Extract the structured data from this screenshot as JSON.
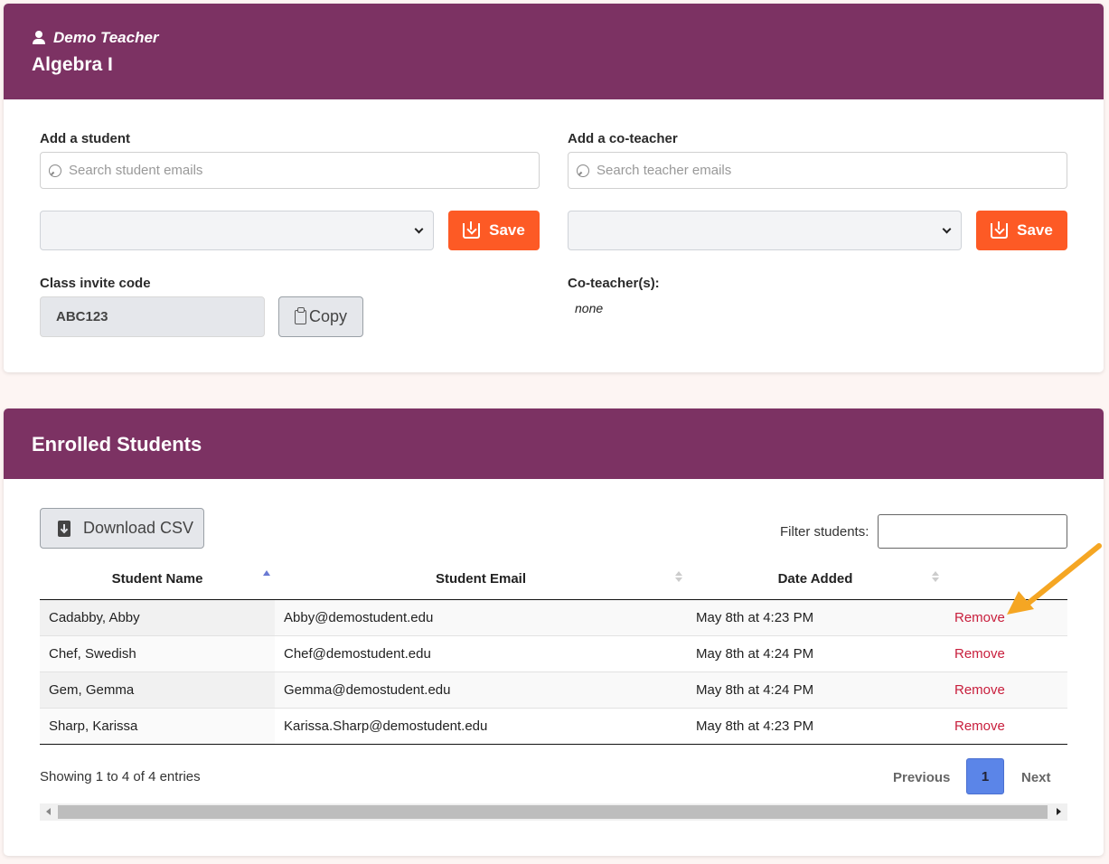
{
  "header": {
    "teacher_name": "Demo Teacher",
    "class_title": "Algebra I"
  },
  "add_student": {
    "label": "Add a student",
    "placeholder": "Search student emails",
    "save_label": "Save"
  },
  "add_coteacher": {
    "label": "Add a co-teacher",
    "placeholder": "Search teacher emails",
    "save_label": "Save"
  },
  "invite": {
    "label": "Class invite code",
    "code": "ABC123",
    "copy_label": "Copy"
  },
  "coteachers": {
    "label": "Co-teacher(s):",
    "value": "none"
  },
  "enrolled": {
    "title": "Enrolled Students",
    "download_label": "Download CSV",
    "filter_label": "Filter students:",
    "columns": [
      "Student Name",
      "Student Email",
      "Date Added"
    ],
    "rows": [
      {
        "name": "Cadabby, Abby",
        "email": "Abby@demostudent.edu",
        "date": "May 8th at 4:23 PM",
        "action": "Remove"
      },
      {
        "name": "Chef, Swedish",
        "email": "Chef@demostudent.edu",
        "date": "May 8th at 4:24 PM",
        "action": "Remove"
      },
      {
        "name": "Gem, Gemma",
        "email": "Gemma@demostudent.edu",
        "date": "May 8th at 4:24 PM",
        "action": "Remove"
      },
      {
        "name": "Sharp, Karissa",
        "email": "Karissa.Sharp@demostudent.edu",
        "date": "May 8th at 4:23 PM",
        "action": "Remove"
      }
    ],
    "showing_text": "Showing 1 to 4 of 4 entries",
    "pagination": {
      "previous": "Previous",
      "current_page": "1",
      "next": "Next"
    }
  },
  "colors": {
    "header_bg": "#7c3263",
    "save_button": "#fd5a25",
    "remove_link": "#c81e3c",
    "active_page": "#5b85e8",
    "annotation_arrow": "#f5a623"
  }
}
